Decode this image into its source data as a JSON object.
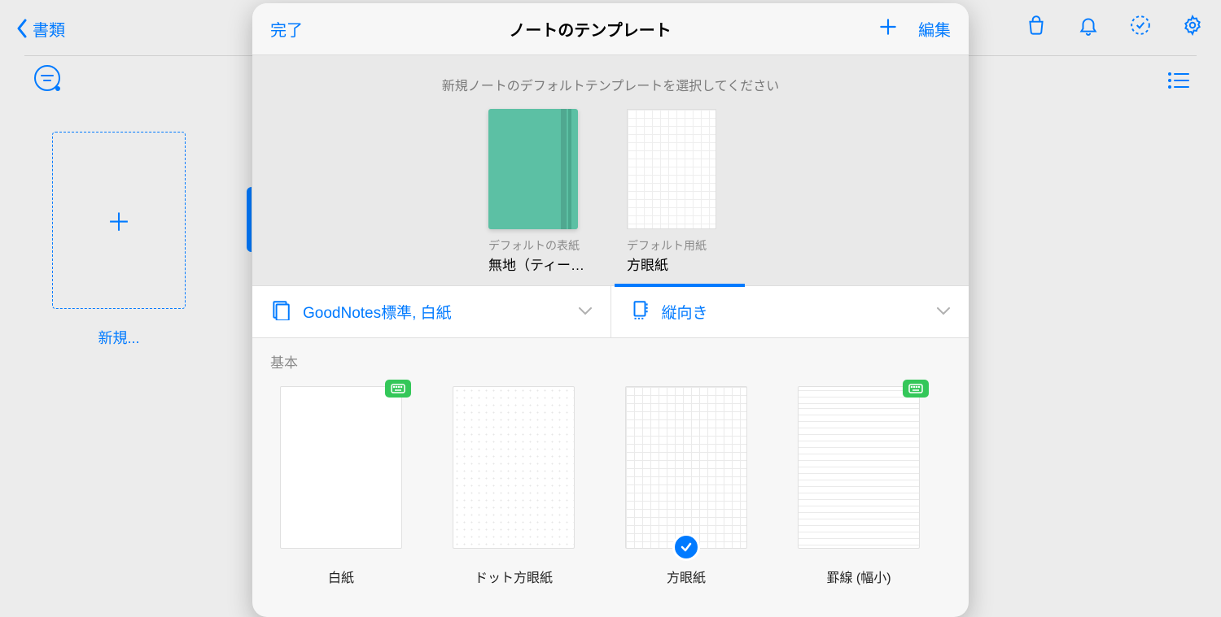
{
  "nav": {
    "back_label": "書類"
  },
  "sidebar": {
    "new_item_label": "新規..."
  },
  "modal": {
    "done_label": "完了",
    "title": "ノートのテンプレート",
    "edit_label": "編集",
    "instruction": "新規ノートのデフォルトテンプレートを選択してください",
    "default_cover": {
      "sublabel": "デフォルトの表紙",
      "label": "無地（ティー…"
    },
    "default_paper": {
      "sublabel": "デフォルト用紙",
      "label": "方眼紙"
    },
    "filter_source": "GoodNotes標準, 白紙",
    "filter_orientation": "縦向き",
    "category_label": "基本",
    "templates": [
      {
        "label": "白紙"
      },
      {
        "label": "ドット方眼紙"
      },
      {
        "label": "方眼紙"
      },
      {
        "label": "罫線 (幅小)"
      }
    ]
  }
}
